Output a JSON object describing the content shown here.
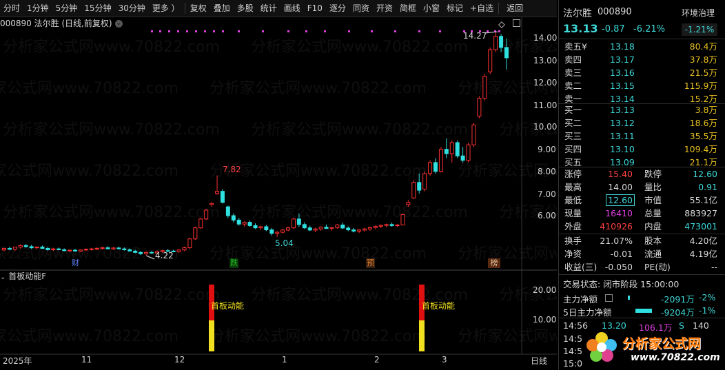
{
  "toolbar": {
    "items": [
      "分时",
      "1分钟",
      "5分钟",
      "15分钟",
      "30分钟",
      "更多 ）",
      "复权",
      "叠加",
      "多股",
      "统计",
      "画线",
      "F10",
      "逐分",
      "同资",
      "开资",
      "简框",
      "小窗",
      "标记",
      "+自选",
      "返回"
    ]
  },
  "chart": {
    "title": "000890 法尔胜 (日线,前复权)",
    "price_axis": [
      "14.00",
      "13.00",
      "12.00",
      "11.00",
      "10.00",
      "9.00",
      "8.00",
      "7.00",
      "6.00"
    ],
    "annotations": {
      "high_peak": "14.27",
      "mid_peak": "7.82",
      "low_left": "4.22",
      "low_mid": "5.04"
    },
    "event_markers": [
      "财",
      "跌",
      "预",
      "榜"
    ],
    "date_axis": [
      "2025年",
      "11",
      "12",
      "1",
      "2",
      "3"
    ],
    "period_label": "日线"
  },
  "indicator": {
    "title": "首板动能F",
    "axis": [
      "20.00",
      "10.00"
    ],
    "signal_label": "首板动能"
  },
  "watermark": {
    "text": "分析家公式网www.70822.com",
    "logo_text": "分析家公式网",
    "logo_url": "www.70822.com"
  },
  "quote": {
    "name": "法尔胜",
    "code": "000890",
    "env_button": "环境治理",
    "env_change": "-1.21%",
    "price": "13.13",
    "change": "-0.87",
    "change_pct": "-6.21%",
    "asks": [
      {
        "label": "卖五",
        "mark": "¥",
        "price": "13.18",
        "vol": "80.4万"
      },
      {
        "label": "卖四",
        "mark": "",
        "price": "13.17",
        "vol": "37.8万"
      },
      {
        "label": "卖三",
        "mark": "",
        "price": "13.16",
        "vol": "21.5万"
      },
      {
        "label": "卖二",
        "mark": "",
        "price": "13.15",
        "vol": "115.9万"
      },
      {
        "label": "卖一",
        "mark": "",
        "price": "13.14",
        "vol": "15.2万"
      }
    ],
    "bids": [
      {
        "label": "买一",
        "price": "13.13",
        "vol": "3.8万"
      },
      {
        "label": "买二",
        "price": "13.12",
        "vol": "18.6万"
      },
      {
        "label": "买三",
        "price": "13.11",
        "vol": "35.5万"
      },
      {
        "label": "买四",
        "price": "13.10",
        "vol": "109.4万"
      },
      {
        "label": "买五",
        "price": "13.09",
        "vol": "21.1万"
      }
    ],
    "stats": [
      {
        "l1": "涨停",
        "v1": "15.40",
        "l2": "跌停",
        "v2": "12.60"
      },
      {
        "l1": "最高",
        "v1": "14.00",
        "l2": "量比",
        "v2": "0.91"
      },
      {
        "l1": "最低",
        "v1": "12.60",
        "l2": "市值",
        "v2": "55.1亿"
      },
      {
        "l1": "现量",
        "v1": "16410",
        "l2": "总量",
        "v2": "883927"
      },
      {
        "l1": "外盘",
        "v1": "410926",
        "l2": "内盘",
        "v2": "473001"
      }
    ],
    "stats2": [
      {
        "l1": "换手",
        "v1": "21.07%",
        "l2": "股本",
        "v2": "4.20亿"
      },
      {
        "l1": "净资",
        "v1": "-0.01",
        "l2": "流通",
        "v2": "4.19亿"
      },
      {
        "l1": "收益(三)",
        "v1": "-0.050",
        "l2": "PE(动)",
        "v2": "--"
      }
    ],
    "trade_status_label": "交易状态:",
    "trade_status": "闭市阶段 15:00:00",
    "main_flow_label": "主力净额",
    "main_flow": "-2091万",
    "main_flow_pct": "-2%",
    "main_flow5_label": "5日主力净额",
    "main_flow5": "-9204万",
    "main_flow5_pct": "-1%",
    "ticks": [
      {
        "time": "14:56",
        "price": "13.20",
        "vol": "106.1万",
        "side": "S",
        "num": "140"
      },
      {
        "time": "14:5",
        "price": "",
        "vol": "",
        "side": "",
        "num": ""
      },
      {
        "time": "14:5",
        "price": "",
        "vol": "",
        "side": "",
        "num": ""
      },
      {
        "time": "15:0",
        "price": "",
        "vol": "",
        "side": "",
        "num": ""
      }
    ]
  },
  "colors": {
    "up": "#ff3030",
    "down": "#30e0e0",
    "signal_red": "#e01010",
    "signal_yellow": "#f0e020"
  }
}
